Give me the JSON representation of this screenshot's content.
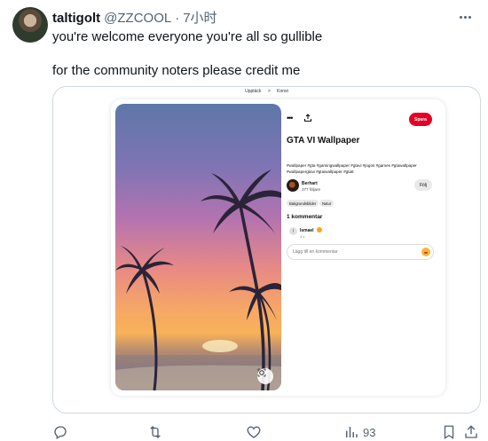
{
  "author": {
    "name": "taltigolt",
    "handle": "@ZZCOOL",
    "separator": "·",
    "time": "7小时"
  },
  "text": {
    "line1": "you're welcome everyone you're all so gullible",
    "line2": "for the community noters please credit me"
  },
  "screenshot": {
    "breadcrumb": [
      "Upptäck",
      ">",
      "Konst"
    ],
    "save_label": "Spara",
    "pin_title": "GTA VI Wallpaper",
    "tags": "#wallpaper #gta #gamingwallpaper #gtavi #jogos #games #gtawallpaper #wallpapergtavi #gtaiwallpaper #gta6",
    "creator": {
      "name": "Berhart",
      "followers": "377 följare"
    },
    "follow_label": "Följ",
    "chips": [
      "Bakgrundsbilder",
      "Natur"
    ],
    "comments_heading": "1 kommentar",
    "comment": {
      "user": "Ismael",
      "avatar_letter": "I",
      "meta": "1 v"
    },
    "comment_placeholder": "Lägg till en kommentar"
  },
  "actions": {
    "views_count": "93"
  },
  "colors": {
    "accent_red": "#e60023",
    "text_secondary": "#536471"
  },
  "icons": [
    "more-icon",
    "reply-icon",
    "retweet-icon",
    "like-icon",
    "views-icon",
    "bookmark-icon",
    "share-icon",
    "lens-icon",
    "emoji-icon"
  ]
}
